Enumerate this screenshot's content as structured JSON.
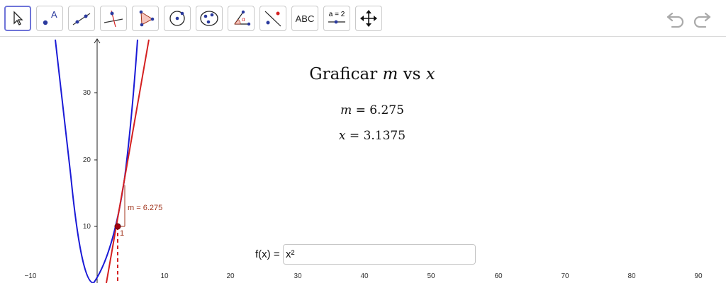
{
  "toolbar": {
    "tools": [
      {
        "name": "move",
        "icon": "arrow-pointer-icon"
      },
      {
        "name": "point",
        "icon": "point-icon",
        "label": "A"
      },
      {
        "name": "line",
        "icon": "line-icon"
      },
      {
        "name": "perpendicular-line",
        "icon": "perpendicular-line-icon"
      },
      {
        "name": "polygon",
        "icon": "polygon-icon"
      },
      {
        "name": "circle",
        "icon": "circle-icon"
      },
      {
        "name": "ellipse",
        "icon": "ellipse-icon"
      },
      {
        "name": "angle",
        "icon": "angle-icon",
        "label": "α"
      },
      {
        "name": "reflect",
        "icon": "reflect-icon"
      },
      {
        "name": "text",
        "icon": "text-icon",
        "label": "ABC"
      },
      {
        "name": "slider",
        "icon": "slider-icon",
        "label": "a = 2"
      },
      {
        "name": "move-graphics",
        "icon": "move-graphics-icon"
      }
    ],
    "undo_icon": "undo-icon",
    "redo_icon": "redo-icon"
  },
  "text": {
    "title_prefix": "Graficar ",
    "title_m": "m",
    "title_vs": " vs ",
    "title_x": "x",
    "m_var": "m",
    "m_eq": " = 6.275",
    "x_var": "x",
    "x_eq": " = 3.1375"
  },
  "graph": {
    "x_ticks": [
      "−10",
      "10",
      "20",
      "30",
      "40",
      "50",
      "60",
      "70",
      "80",
      "90"
    ],
    "y_ticks": [
      "30",
      "20",
      "10"
    ],
    "slope_label": "m = 6.275",
    "slope_triangle_label": "1",
    "function_color": "#1a1ad6",
    "tangent_color": "#d42020",
    "point_color": "#a5000f",
    "point_x": 3.1375,
    "slope": 6.275
  },
  "input": {
    "label": "f(x) =",
    "value": "x²"
  },
  "colors": {
    "selected_tool_border": "#6e74d8",
    "function_curve": "#1a1ad6",
    "tangent_line": "#d42020"
  }
}
